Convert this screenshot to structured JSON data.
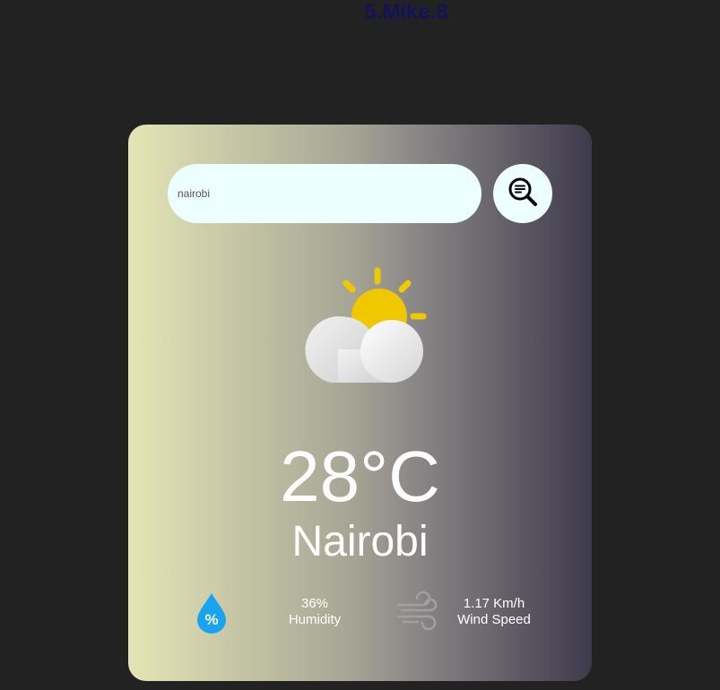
{
  "header": {
    "title": "5.Mike.8"
  },
  "search": {
    "value": "nairobi"
  },
  "weather": {
    "icon": "sun-cloud-icon",
    "temperature": "28°C",
    "city": "Nairobi"
  },
  "details": {
    "humidity": {
      "value": "36%",
      "label": "Humidity",
      "icon": "humidity-drop-icon"
    },
    "wind": {
      "value": "1.17 Km/h",
      "label": "Wind Speed",
      "icon": "wind-icon"
    }
  },
  "colors": {
    "background": "#222222",
    "title": "#15125a",
    "input_bg": "#ecfefe",
    "sun": "#f0c800",
    "humidity_icon": "#1aa3f0"
  }
}
